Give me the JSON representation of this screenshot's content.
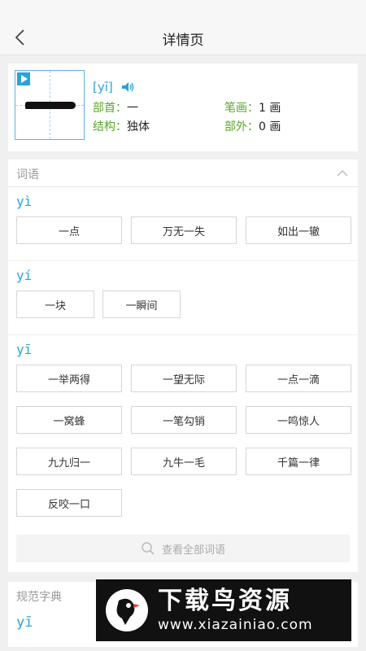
{
  "header": {
    "title": "详情页"
  },
  "char": {
    "pinyin": "[yī]",
    "radical_label": "部首：",
    "radical_value": "一",
    "strokes_label": "笔画：",
    "strokes_value": "1 画",
    "structure_label": "结构：",
    "structure_value": "独体",
    "outside_label": "部外：",
    "outside_value": "0 画"
  },
  "words_section": {
    "label": "词语",
    "groups": [
      {
        "pinyin": "yì",
        "words": [
          "一点",
          "万无一失",
          "如出一辙"
        ]
      },
      {
        "pinyin": "yí",
        "words": [
          "一块",
          "一瞬间"
        ]
      },
      {
        "pinyin": "yī",
        "words": [
          "一举两得",
          "一望无际",
          "一点一滴",
          "一窝蜂",
          "一笔勾销",
          "一鸣惊人",
          "九九归一",
          "九牛一毛",
          "千篇一律",
          "反咬一口"
        ]
      }
    ],
    "view_all": "查看全部词语"
  },
  "dict_section": {
    "label": "规范字典",
    "pinyin": "yī"
  },
  "banner": {
    "title": "下载鸟资源",
    "url": "www.xiazainiao.com"
  },
  "colors": {
    "accent": "#2aa3dd",
    "label_green": "#5aa62a"
  }
}
